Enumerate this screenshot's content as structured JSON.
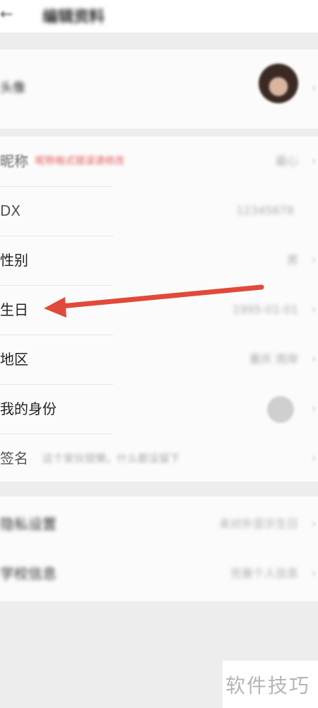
{
  "header": {
    "back_icon": "←",
    "title": "编辑资料"
  },
  "avatar_row": {
    "label": "头像"
  },
  "profile": {
    "nickname": {
      "label": "昵称",
      "hint": "昵称格式错误请修改",
      "value": "最心"
    },
    "id": {
      "label": "DX",
      "value": "12345678"
    },
    "gender": {
      "label": "性别",
      "value": "男"
    },
    "birthday": {
      "label": "生日",
      "value": "1995-01-01"
    },
    "region": {
      "label": "地区",
      "value": "重庆 南岸"
    },
    "identity": {
      "label": "我的身份"
    },
    "signature": {
      "label": "签名",
      "placeholder": "这个家伙很懒，什么都没留下"
    }
  },
  "extra": {
    "item1": {
      "label": "隐私设置",
      "value": "未对外显示生日"
    },
    "item2": {
      "label": "学校信息",
      "value": "完善个人信息"
    }
  },
  "chevron": "›",
  "watermark": "软件技巧",
  "colors": {
    "arrow": "#e04a3a",
    "nickname_hint": "#e85a5a",
    "background": "#ededed",
    "card": "#fbfbfb"
  }
}
